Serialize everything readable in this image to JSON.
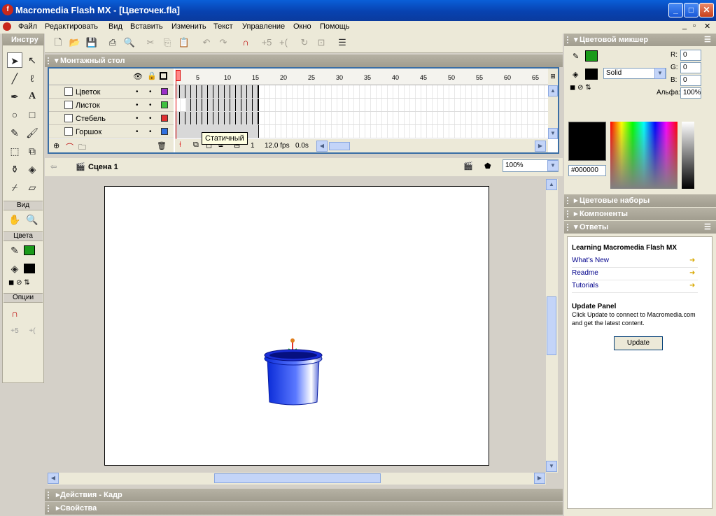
{
  "window": {
    "title": "Macromedia Flash MX - [Цветочек.fla]"
  },
  "menu": [
    "Файл",
    "Редактировать",
    "Вид",
    "Вставить",
    "Изменить",
    "Текст",
    "Управление",
    "Окно",
    "Помощь"
  ],
  "tools": {
    "header": "Инстру",
    "view_label": "Вид",
    "colors_label": "Цвета",
    "options_label": "Опции"
  },
  "timeline": {
    "title": "Монтажный стол",
    "ruler_ticks": [
      "1",
      "5",
      "10",
      "15",
      "20",
      "25",
      "30",
      "35",
      "40",
      "45",
      "50",
      "55",
      "60",
      "65"
    ],
    "layers": [
      {
        "name": "Цветок",
        "color": "#9b30c8"
      },
      {
        "name": "Листок",
        "color": "#40c040"
      },
      {
        "name": "Стебель",
        "color": "#e03030"
      },
      {
        "name": "Горшок",
        "color": "#3070e0"
      }
    ],
    "status": {
      "frame": "1",
      "fps": "12.0 fps",
      "time": "0.0s"
    },
    "tooltip": "Статичный"
  },
  "scene": {
    "name": "Сцена 1",
    "zoom": "100%"
  },
  "bottom_panels": {
    "actions": "Действия - Кадр",
    "properties": "Свойства"
  },
  "color_mixer": {
    "title": "Цветовой микшер",
    "r_label": "R:",
    "g_label": "G:",
    "b_label": "B:",
    "alpha_label": "Альфа:",
    "r": "0",
    "g": "0",
    "b": "0",
    "alpha": "100%",
    "fill_type": "Solid",
    "hex": "#000000",
    "stroke_color": "#1a9a1a",
    "fill_color": "#000000"
  },
  "collapsed_panels": {
    "swatches": "Цветовые наборы",
    "components": "Компоненты"
  },
  "answers": {
    "title": "Ответы",
    "heading": "Learning Macromedia Flash MX",
    "links": [
      "What's New",
      "Readme",
      "Tutorials"
    ],
    "update_heading": "Update Panel",
    "update_text_1": "Click Update to connect to Macromedia.com",
    "update_text_2": "and get the latest content.",
    "update_button": "Update"
  }
}
